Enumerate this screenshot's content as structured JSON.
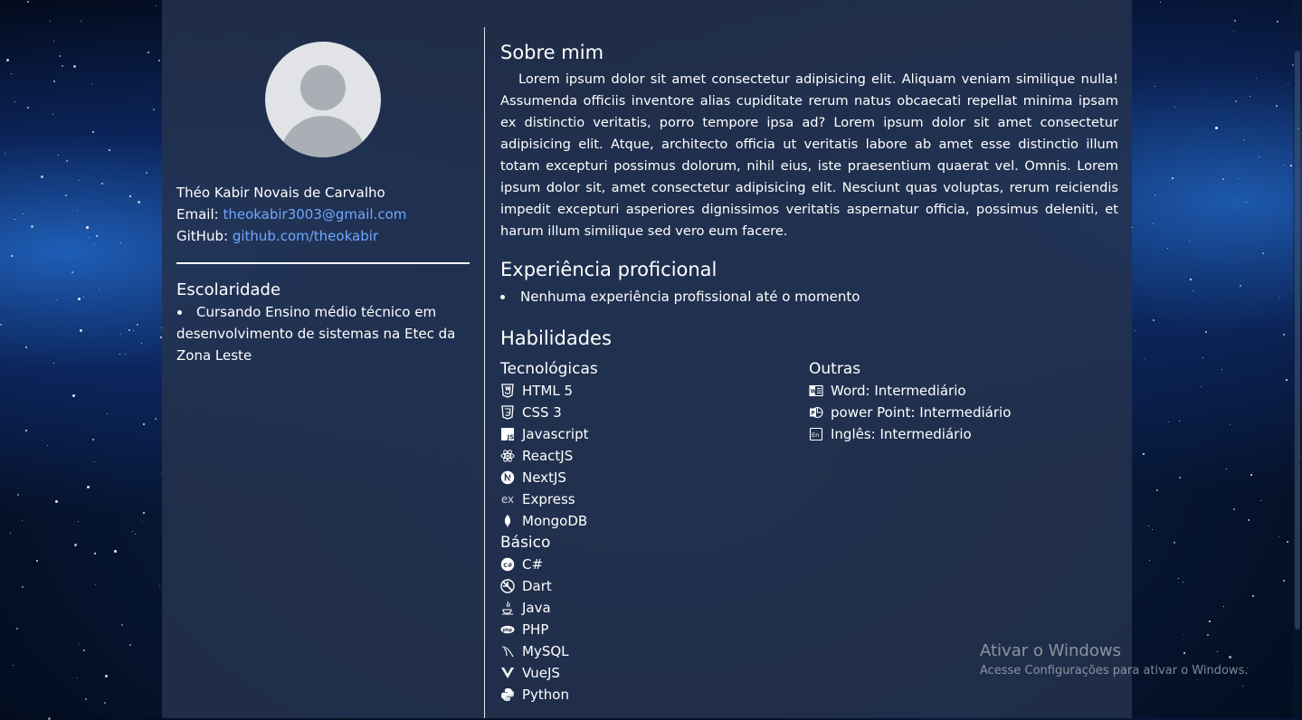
{
  "profile": {
    "name": "Théo Kabir Novais de Carvalho",
    "email_label": "Email:",
    "email": "theokabir3003@gmail.com",
    "github_label": "GitHub:",
    "github": "github.com/theokabir"
  },
  "education": {
    "title": "Escolaridade",
    "items": [
      "Cursando Ensino médio técnico em desenvolvimento de sistemas na Etec da Zona Leste"
    ]
  },
  "about": {
    "title": "Sobre mim",
    "text": "Lorem ipsum dolor sit amet consectetur adipisicing elit. Aliquam veniam similique nulla! Assumenda officiis inventore alias cupiditate rerum natus obcaecati repellat minima ipsam ex distinctio veritatis, porro tempore ipsa ad? Lorem ipsum dolor sit amet consectetur adipisicing elit. Atque, architecto officia ut veritatis labore ab amet esse distinctio illum totam excepturi possimus dolorum, nihil eius, iste praesentium quaerat vel. Omnis. Lorem ipsum dolor sit, amet consectetur adipisicing elit. Nesciunt quas voluptas, rerum reiciendis impedit excepturi asperiores dignissimos veritatis aspernatur officia, possimus deleniti, et harum illum similique sed vero eum facere."
  },
  "experience": {
    "title": "Experiência proficional",
    "items": [
      "Nenhuma experiência profissional até o momento"
    ]
  },
  "skills": {
    "title": "Habilidades",
    "tech_title": "Tecnológicas",
    "tech": [
      {
        "label": "HTML 5",
        "icon": "html5-icon"
      },
      {
        "label": "CSS 3",
        "icon": "css3-icon"
      },
      {
        "label": "Javascript",
        "icon": "javascript-icon"
      },
      {
        "label": "ReactJS",
        "icon": "react-icon"
      },
      {
        "label": "NextJS",
        "icon": "nextjs-icon"
      },
      {
        "label": "Express",
        "icon": "express-icon"
      },
      {
        "label": "MongoDB",
        "icon": "mongodb-icon"
      }
    ],
    "basic_title": "Básico",
    "basic": [
      {
        "label": "C#",
        "icon": "csharp-icon"
      },
      {
        "label": "Dart",
        "icon": "dart-icon"
      },
      {
        "label": "Java",
        "icon": "java-icon"
      },
      {
        "label": "PHP",
        "icon": "php-icon"
      },
      {
        "label": "MySQL",
        "icon": "mysql-icon"
      },
      {
        "label": "VueJS",
        "icon": "vuejs-icon"
      },
      {
        "label": "Python",
        "icon": "python-icon"
      }
    ],
    "other_title": "Outras",
    "other": [
      {
        "label": "Word: Intermediário",
        "icon": "word-icon"
      },
      {
        "label": "power Point: Intermediário",
        "icon": "powerpoint-icon"
      },
      {
        "label": "Inglês: Intermediário",
        "icon": "english-icon"
      }
    ]
  },
  "watermark": {
    "title": "Ativar o Windows",
    "subtitle": "Acesse Configurações para ativar o Windows."
  },
  "colors": {
    "link": "#6ea8ff",
    "panel": "#24324e",
    "text": "#ffffff"
  }
}
